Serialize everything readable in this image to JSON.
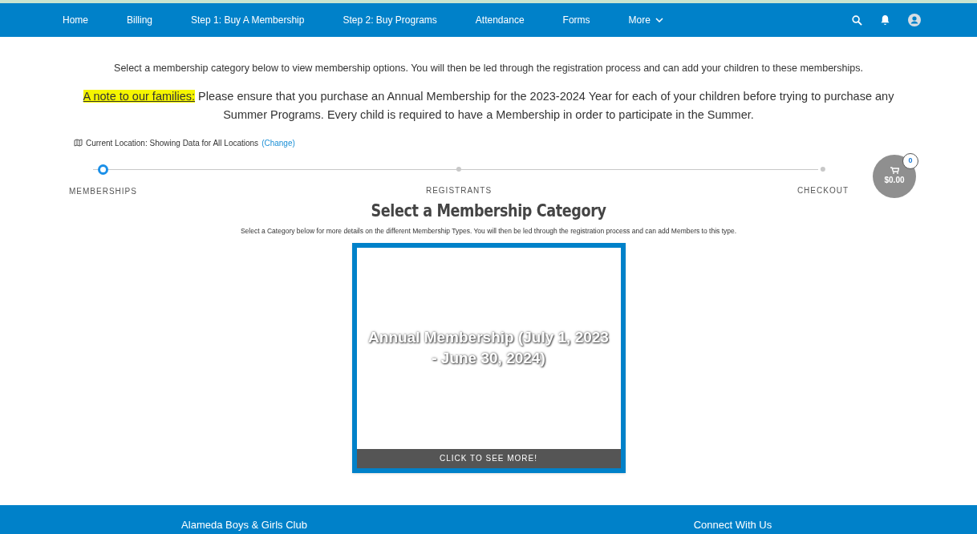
{
  "nav": {
    "items": [
      {
        "label": "Home",
        "kind": "link"
      },
      {
        "label": "Billing",
        "kind": "link"
      },
      {
        "label": "Step 1: Buy A Membership",
        "kind": "link"
      },
      {
        "label": "Step 2: Buy Programs",
        "kind": "link"
      },
      {
        "label": "Attendance",
        "kind": "link"
      },
      {
        "label": "Forms",
        "kind": "link"
      },
      {
        "label": "More",
        "kind": "dropdown"
      }
    ]
  },
  "intro": "Select a membership category below to view membership options. You will then be led through the registration process and can add your children to these memberships.",
  "note": {
    "label": "A note to our families:",
    "text": " Please ensure that you purchase an Annual Membership for the 2023-2024 Year for each of your children before trying to purchase any Summer Programs. Every child is required to have a Membership in order to participate in the Summer."
  },
  "location": {
    "text": "Current Location: Showing Data for All Locations",
    "link": "(Change)"
  },
  "steps": [
    {
      "label": "MEMBERSHIPS",
      "selected": true
    },
    {
      "label": "REGISTRANTS",
      "selected": false
    },
    {
      "label": "CHECKOUT",
      "selected": false
    }
  ],
  "cart": {
    "count": "0",
    "total": "$0.00"
  },
  "heading": "Select a Membership Category",
  "subheading": "Select a Category below for more details on the different Membership Types. You will then be led through the registration process and can add Members to this type.",
  "categories": [
    {
      "title": "Annual Membership (July 1, 2023 - June 30, 2024)",
      "button": "CLICK TO SEE MORE!"
    }
  ],
  "footer": {
    "columns": [
      "Alameda Boys & Girls Club",
      "Connect With Us"
    ]
  }
}
